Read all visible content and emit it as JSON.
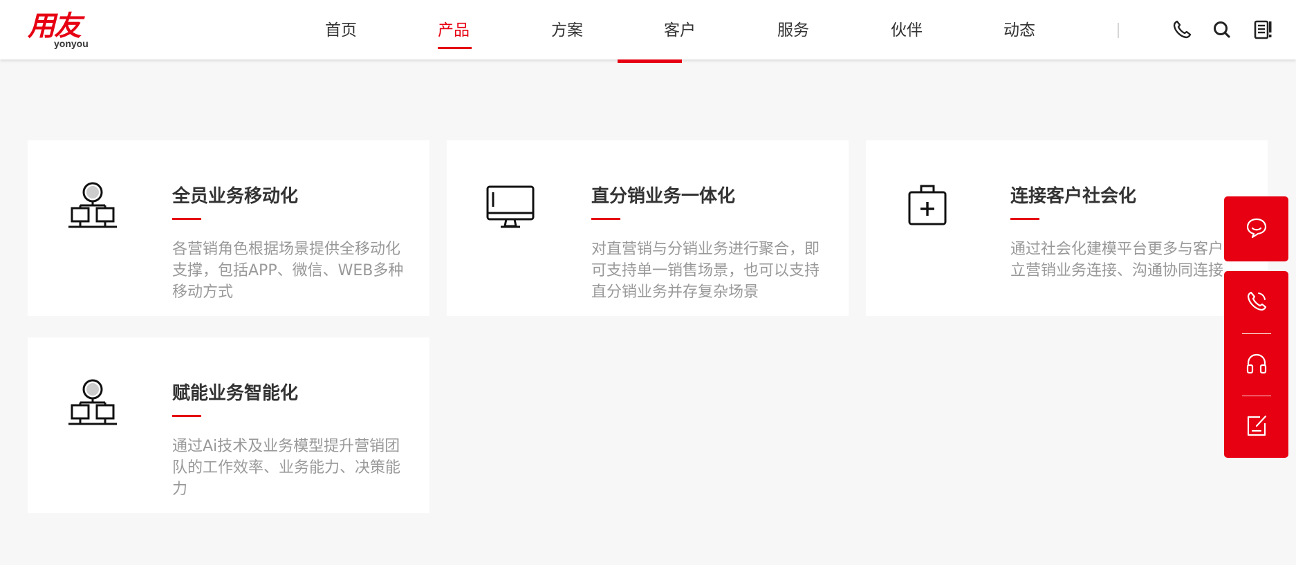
{
  "brand": {
    "logo_text": "用友",
    "logo_subtext": "yonyou",
    "accent_color": "#e60012"
  },
  "nav": {
    "items": [
      {
        "label": "首页"
      },
      {
        "label": "产品",
        "active": true
      },
      {
        "label": "方案"
      },
      {
        "label": "客户"
      },
      {
        "label": "服务"
      },
      {
        "label": "伙伴"
      },
      {
        "label": "动态"
      }
    ],
    "icons": [
      "phone-icon",
      "search-icon",
      "document-icon"
    ]
  },
  "cards": [
    {
      "icon": "network-icon",
      "title": "全员业务移动化",
      "description": "各营销角色根据场景提供全移动化支撑，包括APP、微信、WEB多种移动方式"
    },
    {
      "icon": "monitor-icon",
      "title": "直分销业务一体化",
      "description": "对直营销与分销业务进行聚合，即可支持单一销售场景，也可以支持直分销业务并存复杂场景"
    },
    {
      "icon": "medical-kit-icon",
      "title": "连接客户社会化",
      "description": "通过社会化建模平台更多与客户建立营销业务连接、沟通协同连接"
    },
    {
      "icon": "network-icon",
      "title": "赋能业务智能化",
      "description": "通过Ai技术及业务模型提升营销团队的工作效率、业务能力、决策能力"
    }
  ],
  "side_toolbar": {
    "buttons": [
      "chat-icon",
      "phone-icon",
      "headset-icon",
      "edit-icon"
    ]
  }
}
